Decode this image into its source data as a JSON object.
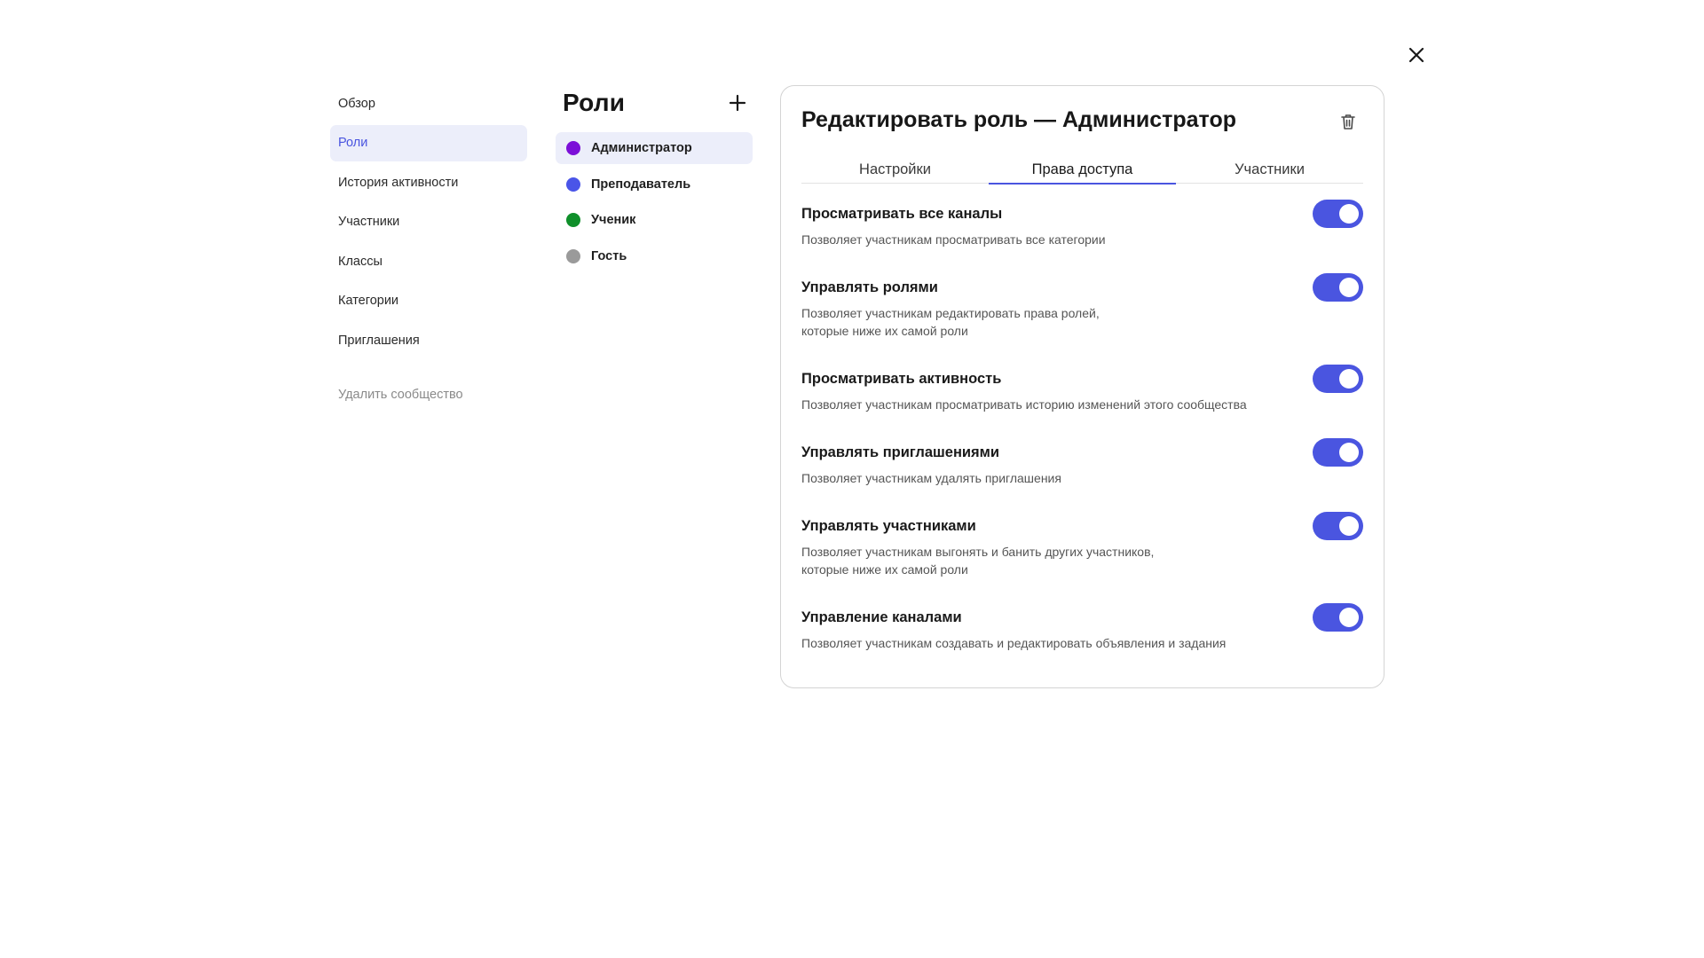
{
  "nav": {
    "items": [
      {
        "label": "Обзор",
        "active": false
      },
      {
        "label": "Роли",
        "active": true
      },
      {
        "label": "История активности",
        "active": false
      },
      {
        "label": "Участники",
        "active": false
      },
      {
        "label": "Классы",
        "active": false
      },
      {
        "label": "Категории",
        "active": false
      },
      {
        "label": "Приглашения",
        "active": false
      }
    ],
    "danger_label": "Удалить сообщество"
  },
  "roles": {
    "title": "Роли",
    "items": [
      {
        "label": "Администратор",
        "color": "#7c0fd8",
        "active": true
      },
      {
        "label": "Преподаватель",
        "color": "#4a55e8",
        "active": false
      },
      {
        "label": "Ученик",
        "color": "#0f8f2a",
        "active": false
      },
      {
        "label": "Гость",
        "color": "#9a9a9a",
        "active": false
      }
    ]
  },
  "panel": {
    "title": "Редактировать роль — Администратор",
    "tabs": [
      {
        "label": "Настройки",
        "active": false
      },
      {
        "label": "Права доступа",
        "active": true
      },
      {
        "label": "Участники",
        "active": false
      }
    ],
    "permissions": [
      {
        "title": "Просматривать все каналы",
        "description": "Позволяет участникам просматривать все категории",
        "enabled": true
      },
      {
        "title": "Управлять ролями",
        "description": "Позволяет участникам редактировать права ролей,\nкоторые ниже их самой роли",
        "enabled": true
      },
      {
        "title": "Просматривать активность",
        "description": "Позволяет участникам просматривать историю изменений этого сообщества",
        "enabled": true
      },
      {
        "title": "Управлять приглашениями",
        "description": "Позволяет участникам удалять приглашения",
        "enabled": true
      },
      {
        "title": "Управлять участниками",
        "description": "Позволяет участникам выгонять и банить других участников,\nкоторые ниже их самой роли",
        "enabled": true
      },
      {
        "title": "Управление каналами",
        "description": "Позволяет участникам создавать и редактировать объявления и задания",
        "enabled": true
      }
    ]
  },
  "icons": {
    "close": "close-icon",
    "add": "plus-icon",
    "delete": "trash-icon"
  },
  "colors": {
    "accent": "#4a55e0",
    "active_bg": "#eceefa"
  }
}
